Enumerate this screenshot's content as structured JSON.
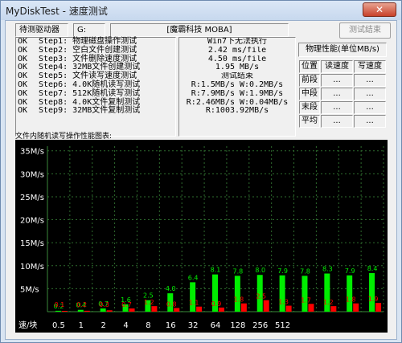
{
  "window": {
    "title": "MyDiskTest - 速度测试",
    "close_symbol": "✕"
  },
  "toolbar": {
    "drive_label": "待测驱动器",
    "drive_letter": "G:",
    "device_name": "[魔霸科技 MOBA]",
    "test_button": "测试结束"
  },
  "steps": [
    {
      "status": "OK",
      "text": "Step1: 物理磁盘操作测试"
    },
    {
      "status": "OK",
      "text": "Step2: 空白文件创建测试"
    },
    {
      "status": "OK",
      "text": "Step3: 文件删除速度测试"
    },
    {
      "status": "OK",
      "text": "Step4: 32MB文件创建测试"
    },
    {
      "status": "OK",
      "text": "Step5: 文件读写速度测试"
    },
    {
      "status": "OK",
      "text": "Step6: 4.0K随机读写测试"
    },
    {
      "status": "OK",
      "text": "Step7: 512K随机读写测试"
    },
    {
      "status": "OK",
      "text": "Step8: 4.0K文件复制测试"
    },
    {
      "status": "OK",
      "text": "Step9: 32MB文件复制测试"
    }
  ],
  "results": [
    "Win7下无法执行",
    "2.42 ms/file",
    "4.50 ms/file",
    "1.95 MB/s",
    "测试结束",
    "R:1.5MB/s W:0.2MB/s",
    "R:7.9MB/s W:1.9MB/s",
    "R:2.46MB/s W:0.04MB/s",
    "R:1003.92MB/s"
  ],
  "performance": {
    "title": "物理性能(单位MB/s)",
    "headers": [
      "位置",
      "读速度",
      "写速度"
    ],
    "rows": [
      {
        "pos": "前段",
        "read": "...",
        "write": "..."
      },
      {
        "pos": "中段",
        "read": "...",
        "write": "..."
      },
      {
        "pos": "末段",
        "read": "...",
        "write": "..."
      },
      {
        "pos": "平均",
        "read": "...",
        "write": "..."
      }
    ]
  },
  "chart_label": "文件内随机读写操作性能图表:",
  "chart_data": {
    "type": "bar",
    "ylabel": "",
    "y_ticks": [
      "5M/s",
      "10M/s",
      "15M/s",
      "20M/s",
      "25M/s",
      "30M/s",
      "35M/s"
    ],
    "ylim": [
      0,
      36
    ],
    "x_axis_label": "速/块",
    "categories": [
      "0.5",
      "1",
      "2",
      "4",
      "8",
      "16",
      "32",
      "64",
      "128",
      "256",
      "512",
      "",
      "",
      "",
      ""
    ],
    "series": [
      {
        "color": "#00ee00",
        "values": [
          0.2,
          0.4,
          0.7,
          1.6,
          2.5,
          4.0,
          6.4,
          8.1,
          7.8,
          8.0,
          7.9,
          7.8,
          8.3,
          7.9,
          8.4
        ]
      },
      {
        "color": "#ff0000",
        "values": [
          0.1,
          0.2,
          0.3,
          0.7,
          1.2,
          0.8,
          1.1,
          0.9,
          1.8,
          2.5,
          1.3,
          1.7,
          1.2,
          1.8,
          1.9
        ]
      }
    ],
    "grid": true
  }
}
